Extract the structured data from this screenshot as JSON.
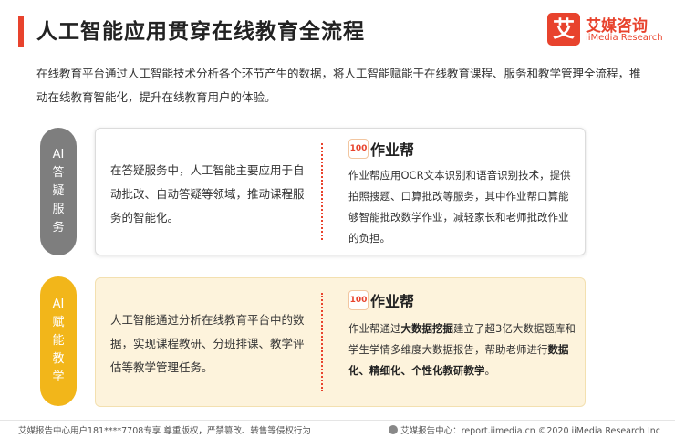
{
  "header": {
    "title": "人工智能应用贯穿在线教育全流程",
    "logo_mark": "艾",
    "logo_cn": "艾媒咨询",
    "logo_en": "iiMedia Research"
  },
  "intro": "在线教育平台通过人工智能技术分析各个环节产生的数据，将人工智能赋能于在线教育课程、服务和教学管理全流程，推动在线教育智能化，提升在线教育用户的体验。",
  "sections": [
    {
      "label": "AI答疑服务",
      "left_text": "在答疑服务中，人工智能主要应用于自动批改、自动答疑等领域，推动课程服务的智能化。",
      "brand_icon": "100",
      "brand_name": "作业帮",
      "right_text": "作业帮应用OCR文本识别和语音识别技术，提供拍照搜题、口算批改等服务，其中作业帮口算能够智能批改数学作业，减轻家长和老师批改作业的负担。"
    },
    {
      "label": "AI赋能教学",
      "left_text": "人工智能通过分析在线教育平台中的数据，实现课程教研、分班排课、教学评估等教学管理任务。",
      "brand_icon": "100",
      "brand_name": "作业帮",
      "right_prefix": "作业帮通过",
      "right_bold1": "大数据挖掘",
      "right_mid": "建立了超3亿大数据题库和学生学情多维度大数据报告，帮助老师进行",
      "right_bold2": "数据化、精细化、个性化教研教学",
      "right_suffix": "。"
    }
  ],
  "footer": {
    "left": "艾媒报告中心用户181****7708专享 尊重版权，严禁篡改、转售等侵权行为",
    "right": "艾媒报告中心：report.iimedia.cn  ©2020 iiMedia Research Inc"
  },
  "colors": {
    "accent": "#e8432d",
    "pill_gray": "#7e7e7e",
    "pill_yellow": "#f2b61a",
    "card_yellow": "#fdf3dc"
  }
}
